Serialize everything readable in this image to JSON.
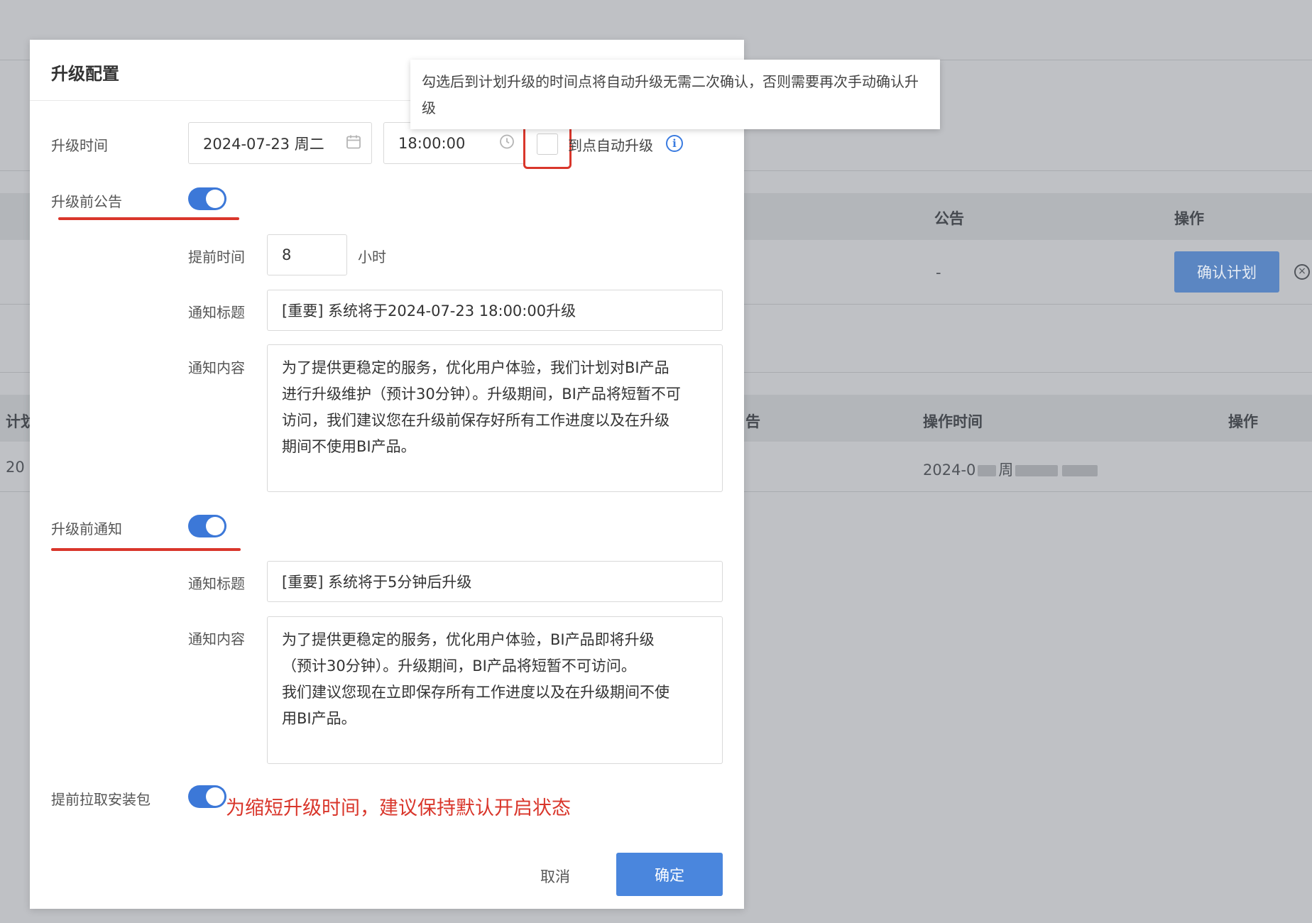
{
  "background": {
    "table1_headers": [
      "公告",
      "操作"
    ],
    "table1_row": {
      "announcement": "-",
      "action_button": "确认计划",
      "close_glyph": "×"
    },
    "table2_headers": {
      "left_fragment": "计划",
      "right_fragment": "告",
      "op_time": "操作时间",
      "op": "操作"
    },
    "table2_row": {
      "left_fragment": "20",
      "op_time_prefix": "2024-0",
      "op_time_mid": "周"
    }
  },
  "dialog": {
    "title": "升级配置",
    "upgrade_time": {
      "label": "升级时间",
      "date_value": "2024-07-23 周二",
      "time_value": "18:00:00",
      "auto_upgrade_label": "到点自动升级"
    },
    "tooltip": {
      "text": "勾选后到计划升级的时间点将自动升级无需二次确认，否则需要再次手动确认升级"
    },
    "announcement": {
      "label": "升级前公告",
      "enabled": true,
      "advance_label": "提前时间",
      "advance_value": "8",
      "advance_unit": "小时",
      "title_label": "通知标题",
      "title_value": "[重要] 系统将于2024-07-23 18:00:00升级",
      "content_label": "通知内容",
      "content_value": "为了提供更稳定的服务，优化用户体验，我们计划对BI产品\n进行升级维护（预计30分钟）。升级期间，BI产品将短暂不可\n访问，我们建议您在升级前保存好所有工作进度以及在升级\n期间不使用BI产品。"
    },
    "notification": {
      "label": "升级前通知",
      "enabled": true,
      "title_label": "通知标题",
      "title_value": "[重要] 系统将于5分钟后升级",
      "content_label": "通知内容",
      "content_value": "为了提供更稳定的服务，优化用户体验，BI产品即将升级\n（预计30分钟）。升级期间，BI产品将短暂不可访问。\n我们建议您现在立即保存所有工作进度以及在升级期间不使\n用BI产品。"
    },
    "prefetch": {
      "label": "提前拉取安装包",
      "enabled": true,
      "annotation": "为缩短升级时间，建议保持默认开启状态"
    },
    "footer": {
      "cancel_label": "取消",
      "ok_label": "确定"
    }
  },
  "colors": {
    "accent": "#3c78d8",
    "primary_button": "#4a86dd",
    "annotation_red": "#d9362b"
  },
  "icons": [
    "calendar-icon",
    "clock-icon",
    "info-icon",
    "close-circle-icon"
  ]
}
